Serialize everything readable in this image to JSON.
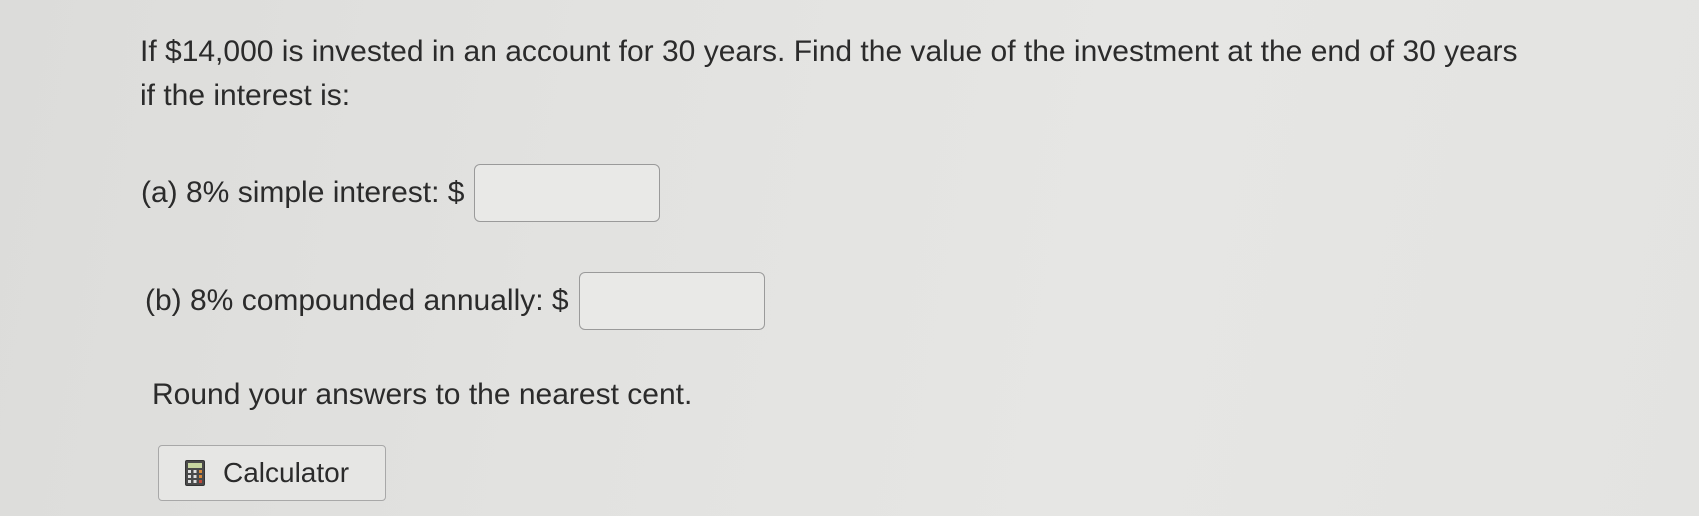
{
  "question": {
    "text": "If $14,000 is invested in an account for 30 years. Find the value of the investment at the end of 30 years if the interest is:"
  },
  "parts": [
    {
      "label": "(a) 8% simple interest: $",
      "value": ""
    },
    {
      "label": "(b) 8% compounded annually: $",
      "value": ""
    }
  ],
  "instruction": "Round your answers to the nearest cent.",
  "calculator": {
    "label": "Calculator",
    "icon": "calculator-icon"
  }
}
